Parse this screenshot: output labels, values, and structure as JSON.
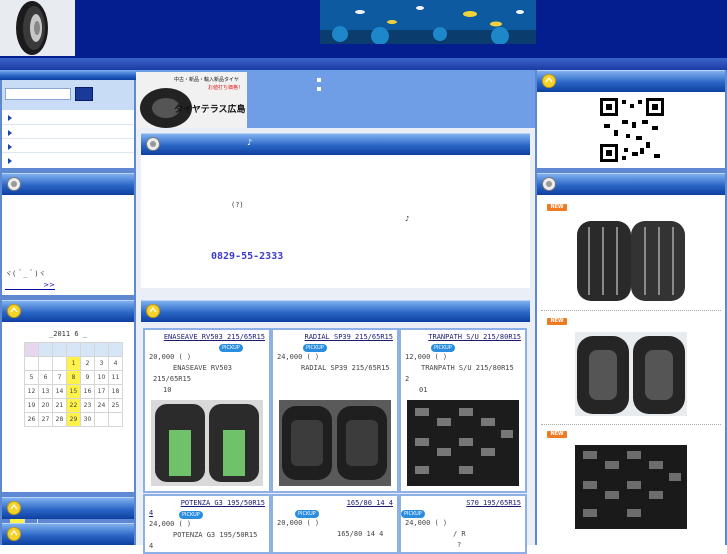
{
  "header": {
    "logo_alt": "tire-logo-image",
    "banner_alt": "aquarium-fish-banner"
  },
  "left": {
    "search": {
      "placeholder": "",
      "button_label": ""
    },
    "nav_items": [
      "",
      "",
      "",
      ""
    ],
    "section2": {
      "emoticon": "ヾ(＾_＾)ヾ",
      "more_link": ">>"
    },
    "calendar": {
      "title": "_2011 6 _",
      "rows": [
        [
          "",
          "",
          "",
          "1",
          "2",
          "3",
          "4"
        ],
        [
          "5",
          "6",
          "7",
          "8",
          "9",
          "10",
          "11"
        ],
        [
          "12",
          "13",
          "14",
          "15",
          "16",
          "17",
          "18"
        ],
        [
          "19",
          "20",
          "21",
          "22",
          "23",
          "24",
          "25"
        ],
        [
          "26",
          "27",
          "28",
          "29",
          "30",
          "",
          ""
        ]
      ]
    }
  },
  "center": {
    "shop_banner": {
      "line1": "中古・新品・輸入新品タイヤ",
      "line2": "お値打ち価格！",
      "shop_name": "タイヤテラス広島"
    },
    "intro": {
      "heading_note": "♪",
      "text1": "(?)",
      "text2": "♪",
      "phone": "0829-55-2333"
    },
    "products": [
      {
        "title": "ENASEAVE RV503 215/65R15",
        "badge": "PICKUP",
        "price": "20,000 ( )",
        "desc1": "ENASEAVE RV503",
        "desc2": "215/65R15",
        "desc3": "10"
      },
      {
        "title": "RADIAL SP39 215/65R15",
        "badge": "PICKUP",
        "price": "24,000 ( )",
        "desc1": "RADIAL SP39 215/65R15",
        "desc2": "",
        "desc3": ""
      },
      {
        "title": "TRANPATH S/U 215/80R15",
        "badge": "PICKUP",
        "price": "12,000 ( )",
        "desc1": "TRANPATH S/U 215/80R15",
        "desc2": "2",
        "desc3": "01"
      },
      {
        "title": "POTENZA G3 195/50R15",
        "title2": "4",
        "badge": "PICKUP",
        "price": "24,000 ( )",
        "desc1": "POTENZA G3 195/50R15",
        "desc2": "4"
      },
      {
        "title": "165/80 14 4",
        "badge": "PICKUP",
        "price": "20,000 ( )",
        "desc1": "165/80 14 4",
        "desc2": ""
      },
      {
        "title": "S70 195/65R15",
        "badge": "PICKUP",
        "price": "24,000 ( )",
        "desc1": "/ R",
        "desc2": "?"
      }
    ]
  },
  "right": {
    "qr_alt": "qr-code",
    "new_badge": "NEW"
  }
}
